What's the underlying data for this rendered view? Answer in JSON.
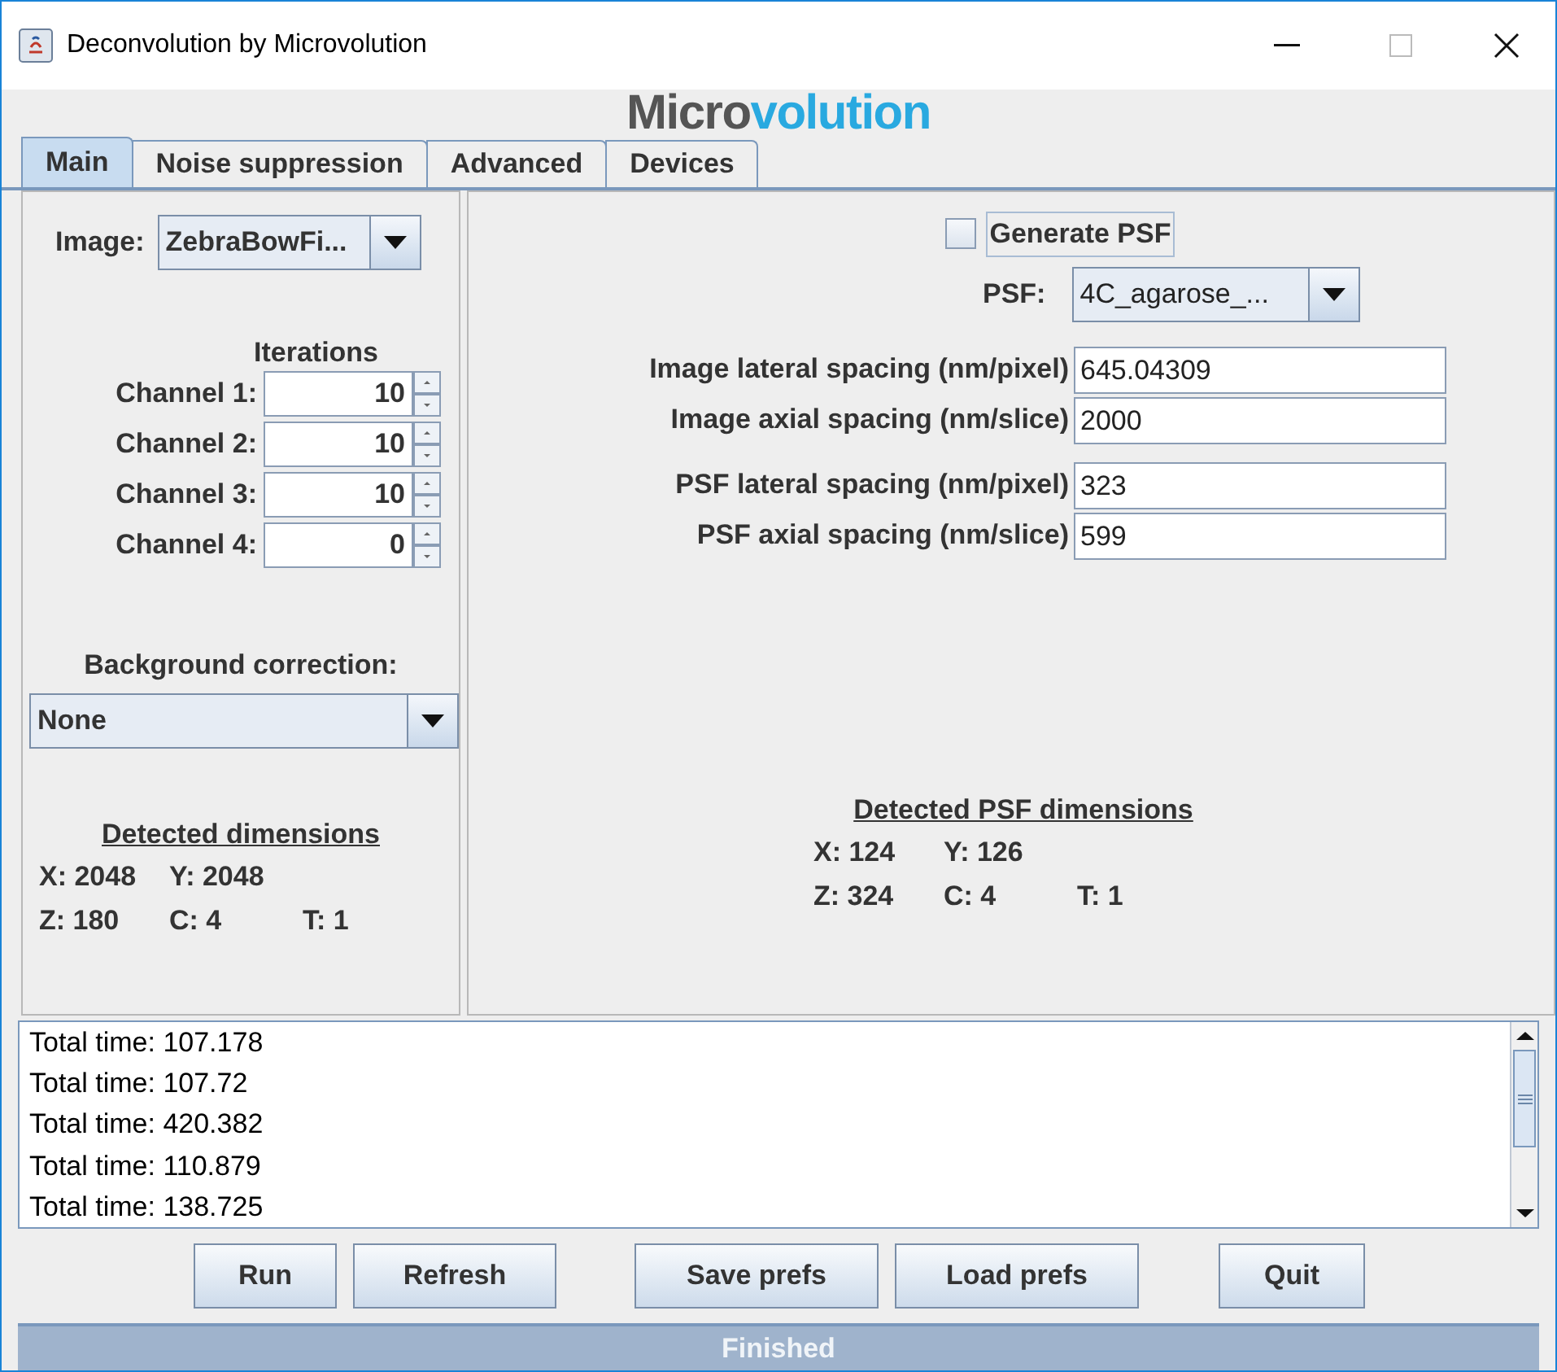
{
  "window": {
    "title": "Deconvolution by Microvolution"
  },
  "logo": {
    "part_1": "Micro",
    "part_2": "volution"
  },
  "tabs": [
    {
      "label": "Main",
      "selected": true
    },
    {
      "label": "Noise suppression",
      "selected": false
    },
    {
      "label": "Advanced",
      "selected": false
    },
    {
      "label": "Devices",
      "selected": false
    }
  ],
  "left_panel": {
    "image": {
      "label": "Image:",
      "value": "ZebraBowFi..."
    },
    "iterations_heading": "Iterations",
    "channels": [
      {
        "label": "Channel 1:",
        "value": "10"
      },
      {
        "label": "Channel 2:",
        "value": "10"
      },
      {
        "label": "Channel 3:",
        "value": "10"
      },
      {
        "label": "Channel 4:",
        "value": "0"
      }
    ],
    "background_correction": {
      "label": "Background correction:",
      "value": "None"
    },
    "dimensions": {
      "heading": "Detected dimensions",
      "rows": [
        [
          "X: 2048",
          "Y: 2048"
        ],
        [
          "Z: 180",
          "C: 4",
          "T: 1"
        ]
      ]
    }
  },
  "right_panel": {
    "generate_psf": {
      "label": "Generate PSF",
      "checked": false
    },
    "psf": {
      "label": "PSF:",
      "value": "4C_agarose_..."
    },
    "fields": [
      {
        "label": "Image lateral spacing (nm/pixel)",
        "value": "645.04309"
      },
      {
        "label": "Image axial spacing (nm/slice)",
        "value": "2000"
      },
      {
        "label": "PSF lateral spacing (nm/pixel)",
        "value": "323"
      },
      {
        "label": "PSF axial spacing (nm/slice)",
        "value": "599"
      }
    ],
    "dimensions": {
      "heading": "Detected PSF dimensions",
      "rows": [
        [
          "X: 124",
          "Y: 126"
        ],
        [
          "Z: 324",
          "C: 4",
          "T: 1"
        ]
      ]
    }
  },
  "log": [
    "Total time: 107.178",
    "Total time: 107.72",
    "Total time: 420.382",
    "Total time: 110.879",
    "Total time: 138.725"
  ],
  "buttons": [
    "Run",
    "Refresh",
    "Save prefs",
    "Load prefs",
    "Quit"
  ],
  "status_bar": {
    "text": "Finished",
    "level": 1
  }
}
